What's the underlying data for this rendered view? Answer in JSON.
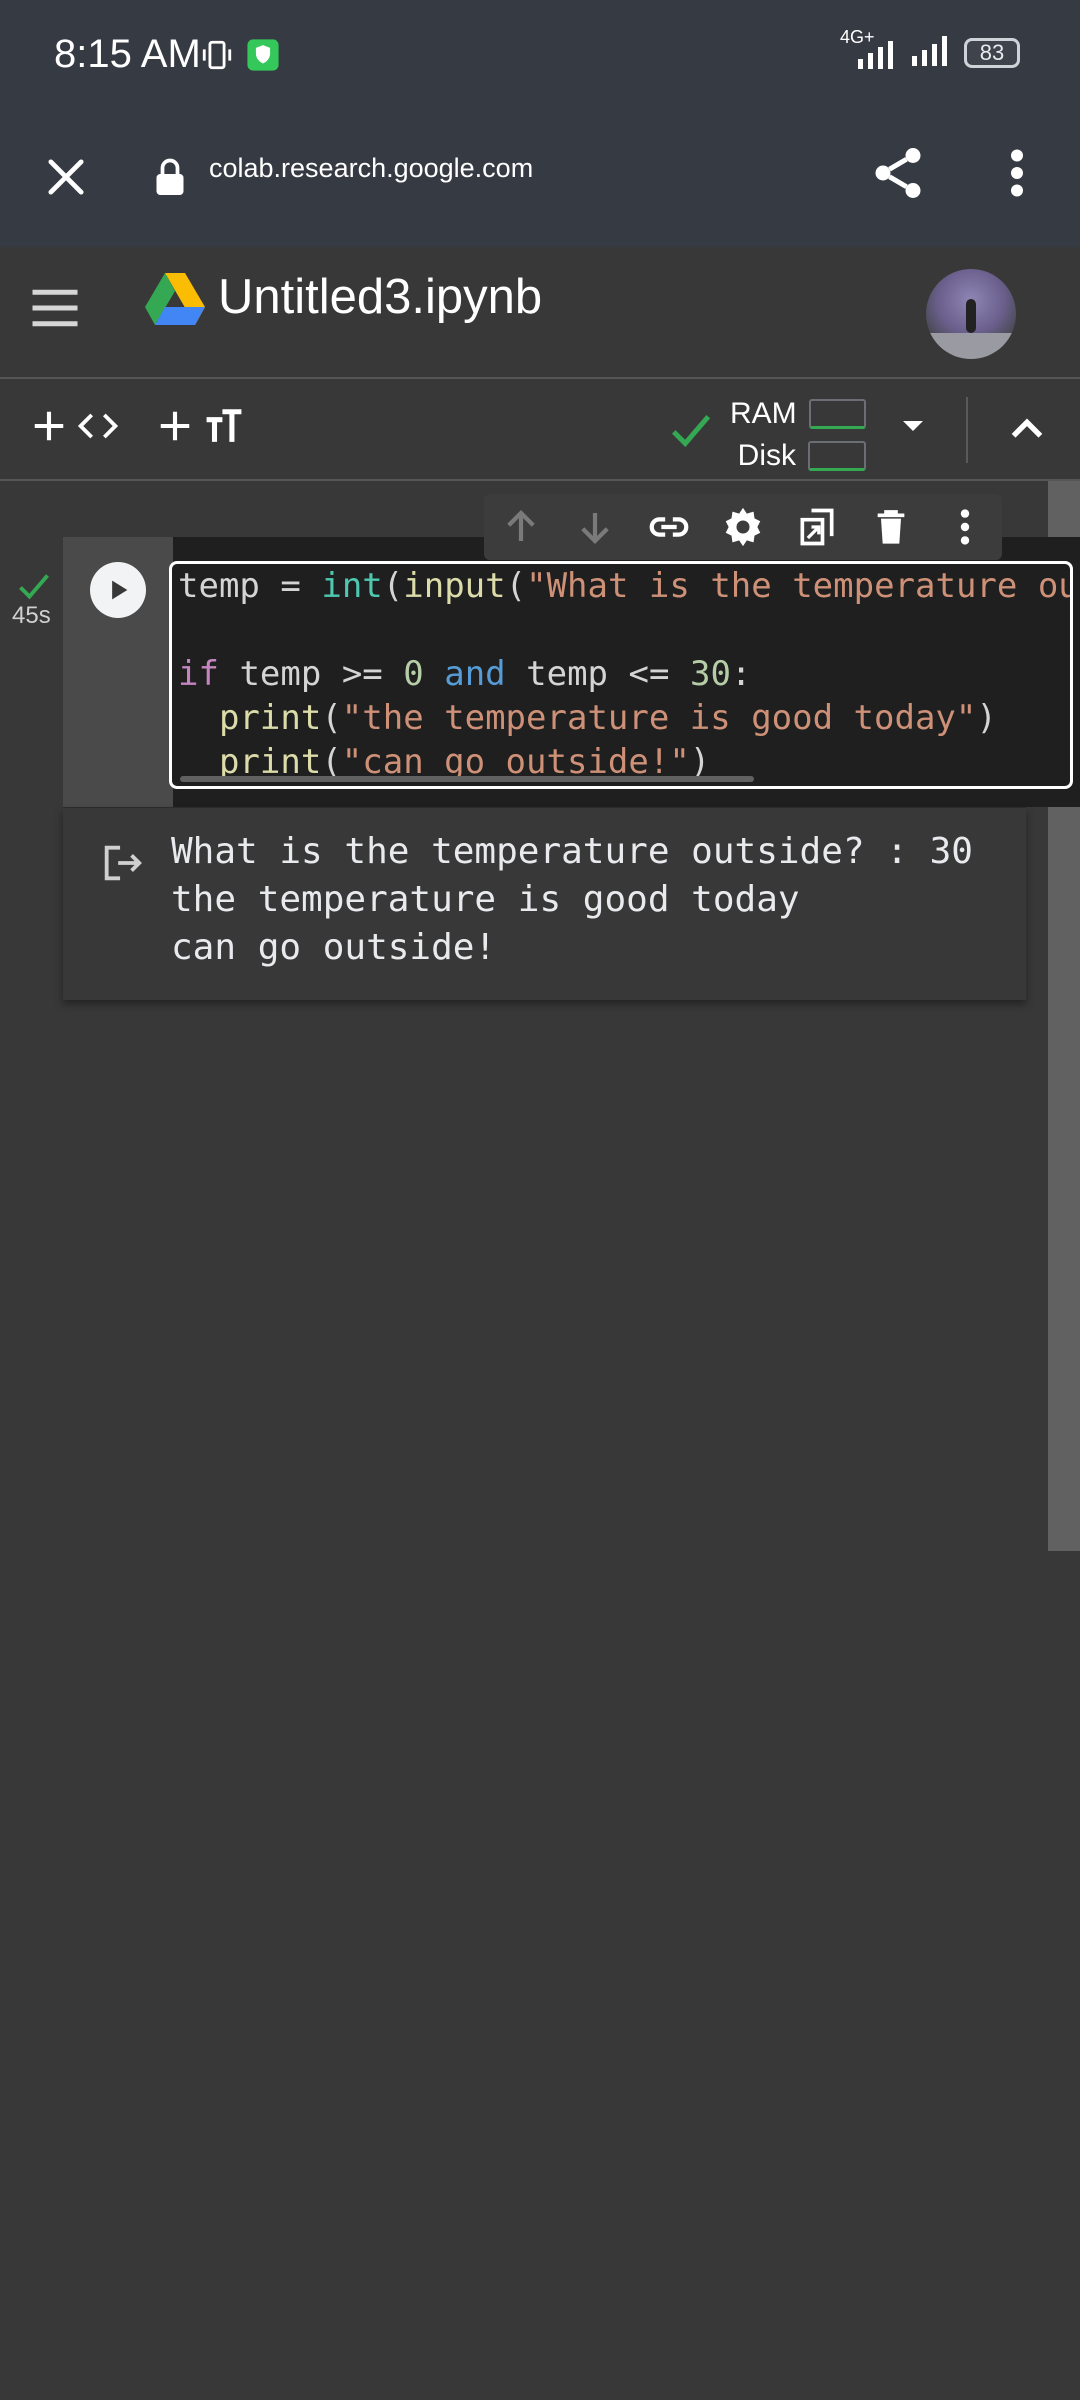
{
  "status": {
    "time": "8:15 AM",
    "network": "4G+",
    "battery": "83"
  },
  "browser": {
    "url": "colab.research.google.com"
  },
  "notebook": {
    "title": "Untitled3.ipynb"
  },
  "toolbar": {
    "ram_label": "RAM",
    "disk_label": "Disk"
  },
  "cell": {
    "exec_time": "45s",
    "code_lines": [
      "temp = int(input(\"What is the temperature outside? : \"))",
      "",
      "if temp >= 0 and temp <= 30:",
      "  print(\"the temperature is good today\")",
      "  print(\"can go outside!\")"
    ],
    "output_lines": [
      "What is the temperature outside? : 30",
      "the temperature is good today",
      "can go outside!"
    ]
  },
  "colors": {
    "background": "#383838",
    "accent_green": "#34a853"
  }
}
